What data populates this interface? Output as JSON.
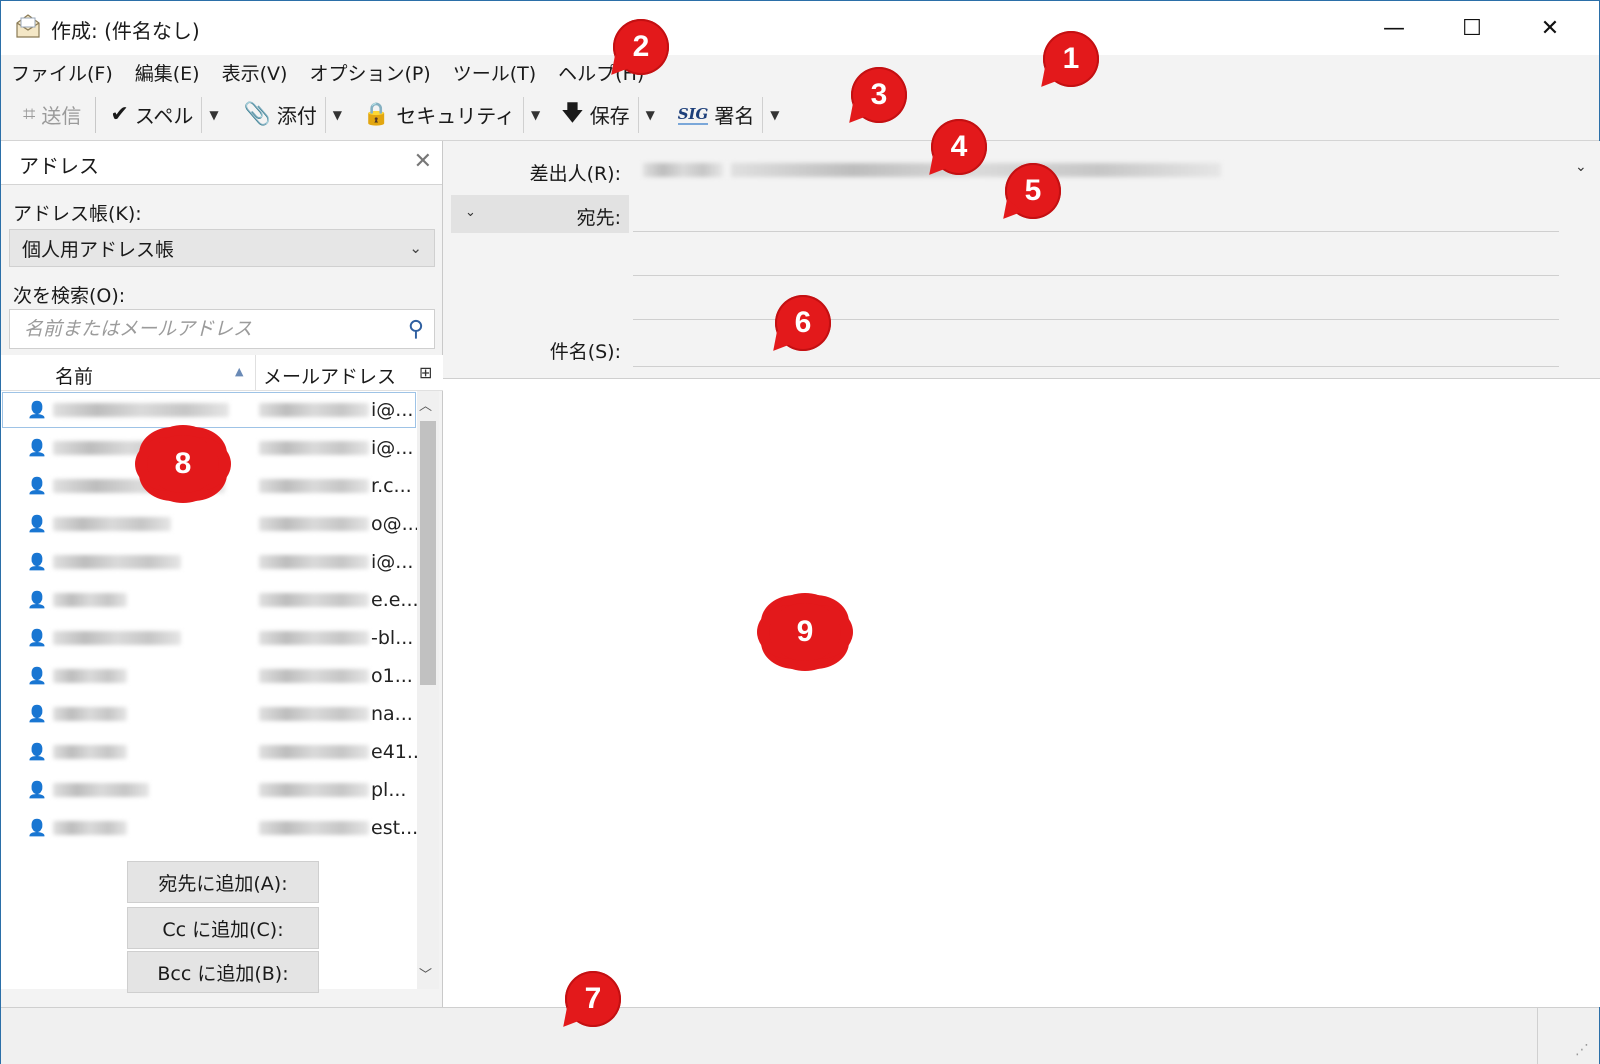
{
  "window": {
    "title": "作成: (件名なし)",
    "minimize_glyph": "—",
    "maximize_glyph": "☐",
    "close_glyph": "✕"
  },
  "menu": [
    "ファイル(F)",
    "編集(E)",
    "表示(V)",
    "オプション(P)",
    "ツール(T)",
    "ヘルプ(H)"
  ],
  "toolbar": {
    "send": "送信",
    "spell": "スペル",
    "attach": "添付",
    "security": "セキュリティ",
    "save": "保存",
    "signature_icon_text": "SIG",
    "signature": "署名"
  },
  "address_pane": {
    "title": "アドレス",
    "close_glyph": "✕",
    "addressbook_label": "アドレス帳(K):",
    "addressbook_value": "個人用アドレス帳",
    "search_label": "次を検索(O):",
    "search_placeholder": "名前またはメールアドレス",
    "columns": {
      "name": "名前",
      "email": "メールアドレス"
    },
    "contacts": [
      {
        "email_tail": "i@..."
      },
      {
        "email_tail": "i@..."
      },
      {
        "email_tail": "r.c..."
      },
      {
        "email_tail": "o@..."
      },
      {
        "email_tail": "i@..."
      },
      {
        "email_tail": "e.e..."
      },
      {
        "email_tail": "-bl..."
      },
      {
        "email_tail": "o1..."
      },
      {
        "email_tail": "na..."
      },
      {
        "email_tail": "e41..."
      },
      {
        "email_tail": "pl..."
      },
      {
        "email_tail": "est...."
      }
    ],
    "buttons": {
      "add_to": "宛先に追加(A):",
      "add_cc": "Cc に追加(C):",
      "add_bcc": "Bcc に追加(B):"
    }
  },
  "compose_header": {
    "from_label": "差出人(R):",
    "to_label": "宛先:",
    "subject_label": "件名(S):",
    "subject_value": ""
  },
  "markers": [
    "1",
    "2",
    "3",
    "4",
    "5",
    "6",
    "7",
    "8",
    "9"
  ],
  "colors": {
    "marker_red": "#e3191b",
    "accent_blue": "#2f5fa0"
  }
}
